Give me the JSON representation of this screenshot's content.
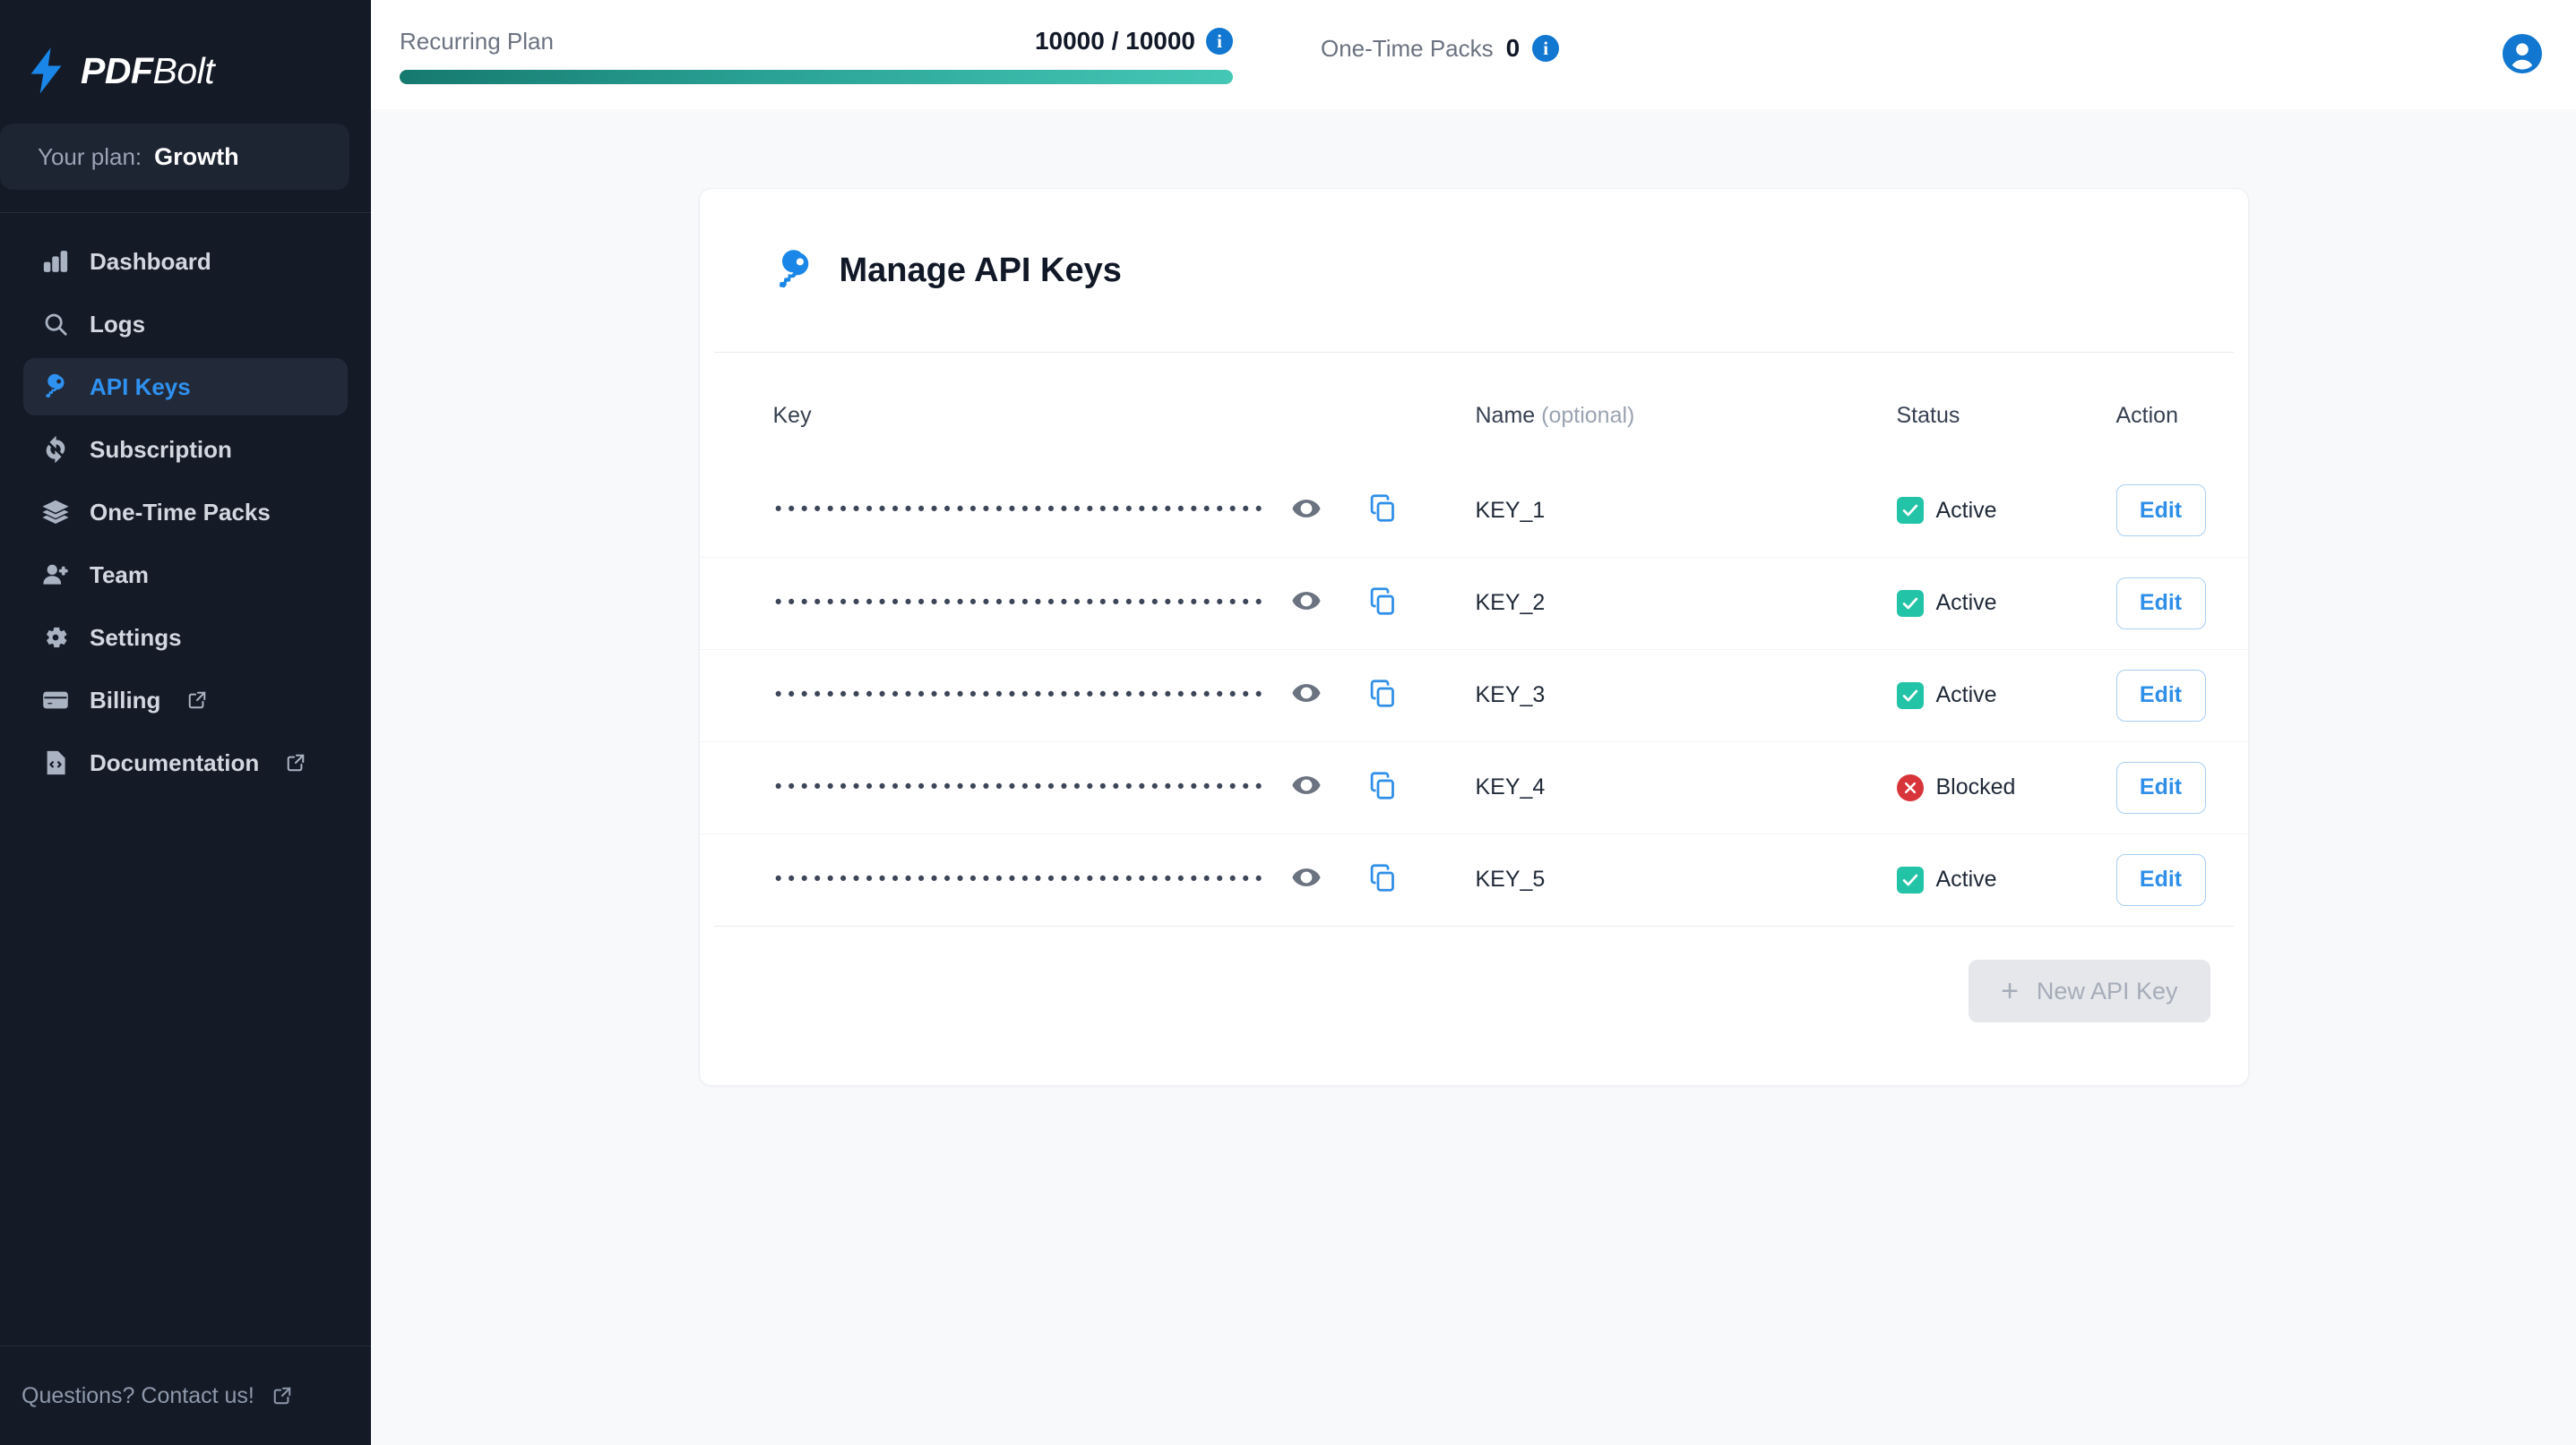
{
  "brand": {
    "name_bold": "PDF",
    "name_light": "Bolt",
    "icon": "lightning-bolt-icon"
  },
  "sidebar": {
    "plan": {
      "label": "Your plan:",
      "value": "Growth"
    },
    "items": [
      {
        "label": "Dashboard",
        "icon": "bar-chart-icon",
        "active": false,
        "external": false
      },
      {
        "label": "Logs",
        "icon": "search-icon",
        "active": false,
        "external": false
      },
      {
        "label": "API Keys",
        "icon": "key-icon",
        "active": true,
        "external": false
      },
      {
        "label": "Subscription",
        "icon": "refresh-icon",
        "active": false,
        "external": false
      },
      {
        "label": "One-Time Packs",
        "icon": "layers-icon",
        "active": false,
        "external": false
      },
      {
        "label": "Team",
        "icon": "person-add-icon",
        "active": false,
        "external": false
      },
      {
        "label": "Settings",
        "icon": "gear-icon",
        "active": false,
        "external": false
      },
      {
        "label": "Billing",
        "icon": "credit-card-icon",
        "active": false,
        "external": true
      },
      {
        "label": "Documentation",
        "icon": "code-file-icon",
        "active": false,
        "external": true
      }
    ],
    "footer": {
      "label": "Questions? Contact us!",
      "icon": "external-link-icon"
    }
  },
  "topbar": {
    "recurring": {
      "label": "Recurring Plan",
      "count": "10000 / 10000",
      "used": 10000,
      "total": 10000,
      "percent": 100,
      "info_icon": "info-icon",
      "bar_color_start": "#16796f",
      "bar_color_end": "#45c7b6"
    },
    "one_time": {
      "label": "One-Time Packs",
      "count": "0",
      "info_icon": "info-icon"
    },
    "avatar": {
      "icon": "user-avatar-icon",
      "color": "#1177d1"
    }
  },
  "card": {
    "title": "Manage API Keys",
    "title_icon": "key-icon",
    "title_icon_color": "#1a86e8",
    "columns": {
      "key": "Key",
      "name": "Name",
      "name_optional": "(optional)",
      "status": "Status",
      "action": "Action"
    },
    "rows": [
      {
        "masked_key": "••••••••••••••••••••••••••••••••••••••",
        "name": "KEY_1",
        "status": "Active",
        "status_type": "active",
        "action": "Edit",
        "eye_icon": "eye-icon",
        "copy_icon": "copy-icon"
      },
      {
        "masked_key": "••••••••••••••••••••••••••••••••••••••",
        "name": "KEY_2",
        "status": "Active",
        "status_type": "active",
        "action": "Edit",
        "eye_icon": "eye-icon",
        "copy_icon": "copy-icon"
      },
      {
        "masked_key": "••••••••••••••••••••••••••••••••••••••",
        "name": "KEY_3",
        "status": "Active",
        "status_type": "active",
        "action": "Edit",
        "eye_icon": "eye-icon",
        "copy_icon": "copy-icon"
      },
      {
        "masked_key": "••••••••••••••••••••••••••••••••••••••",
        "name": "KEY_4",
        "status": "Blocked",
        "status_type": "blocked",
        "action": "Edit",
        "eye_icon": "eye-icon",
        "copy_icon": "copy-icon"
      },
      {
        "masked_key": "••••••••••••••••••••••••••••••••••••••",
        "name": "KEY_5",
        "status": "Active",
        "status_type": "active",
        "action": "Edit",
        "eye_icon": "eye-icon",
        "copy_icon": "copy-icon"
      }
    ],
    "new_key_button": {
      "label": "New API Key",
      "icon": "plus-icon",
      "disabled": true
    }
  },
  "colors": {
    "accent_blue": "#2f8fe8",
    "sidebar_bg": "#141a26",
    "status_active": "#22c3a6",
    "status_blocked": "#d8353a",
    "page_bg": "#f7f9fb"
  }
}
